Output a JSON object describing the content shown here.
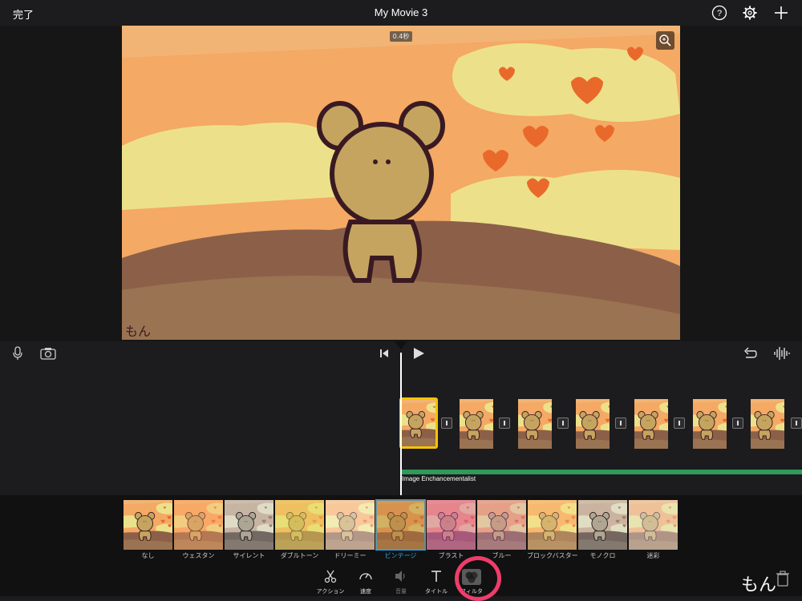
{
  "topbar": {
    "done_label": "完了",
    "title": "My Movie 3"
  },
  "preview": {
    "duration": "0.4秒",
    "signature": "もん"
  },
  "audio": {
    "clip_name": "Image Enchancementalist"
  },
  "filters": [
    {
      "label": "なし",
      "tint": "rgba(0,0,0,0)"
    },
    {
      "label": "ウェスタン",
      "tint": "rgba(255,170,110,0.35)"
    },
    {
      "label": "サイレント",
      "tint": "rgba(0,0,0,0.75)"
    },
    {
      "label": "ダブルトーン",
      "tint": "rgba(230,220,90,0.45)"
    },
    {
      "label": "ドリーミー",
      "tint": "rgba(255,255,255,0.35)"
    },
    {
      "label": "ビンテージ",
      "tint": "rgba(180,120,50,0.45)"
    },
    {
      "label": "ブラスト",
      "tint": "rgba(210,80,200,0.4)"
    },
    {
      "label": "ブルー",
      "tint": "rgba(200,140,220,0.3)"
    },
    {
      "label": "ブロックバスター",
      "tint": "rgba(255,220,140,0.3)"
    },
    {
      "label": "モノクロ",
      "tint": "rgba(200,200,200,0.7)"
    },
    {
      "label": "迷彩",
      "tint": "rgba(230,230,230,0.4)"
    }
  ],
  "selected_filter": "ビンテージ",
  "toolbar": [
    {
      "label": "アクション",
      "icon": "scissors-icon"
    },
    {
      "label": "速度",
      "icon": "speedometer-icon"
    },
    {
      "label": "音量",
      "icon": "speaker-icon"
    },
    {
      "label": "タイトル",
      "icon": "title-icon"
    },
    {
      "label": "フィルタ",
      "icon": "filter-icon"
    }
  ],
  "watermark": "もん",
  "colors": {
    "accent": "#2aa3e8",
    "selection": "#f5c400",
    "audio": "#2f9a5a",
    "annotation": "#f03c6a"
  }
}
